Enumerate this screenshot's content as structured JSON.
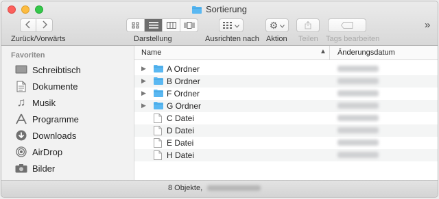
{
  "window": {
    "title": "Sortierung"
  },
  "toolbar": {
    "nav_label": "Zurück/Vorwärts",
    "view_label": "Darstellung",
    "arrange_label": "Ausrichten nach",
    "action_label": "Aktion",
    "share_label": "Teilen",
    "tags_label": "Tags bearbeiten",
    "overflow": "»"
  },
  "sidebar": {
    "heading": "Favoriten",
    "items": [
      {
        "label": "Schreibtisch",
        "icon": "desktop-icon"
      },
      {
        "label": "Dokumente",
        "icon": "document-icon"
      },
      {
        "label": "Musik",
        "icon": "music-icon"
      },
      {
        "label": "Programme",
        "icon": "apps-icon"
      },
      {
        "label": "Downloads",
        "icon": "download-icon"
      },
      {
        "label": "AirDrop",
        "icon": "airdrop-icon"
      },
      {
        "label": "Bilder",
        "icon": "camera-icon"
      }
    ]
  },
  "columns": {
    "name": "Name",
    "date": "Änderungsdatum"
  },
  "files": [
    {
      "name": "A Ordner",
      "type": "folder"
    },
    {
      "name": "B Ordner",
      "type": "folder"
    },
    {
      "name": "F Ordner",
      "type": "folder"
    },
    {
      "name": "G Ordner",
      "type": "folder"
    },
    {
      "name": "C Datei",
      "type": "file"
    },
    {
      "name": "D Datei",
      "type": "file"
    },
    {
      "name": "E Datei",
      "type": "file"
    },
    {
      "name": "H Datei",
      "type": "file"
    }
  ],
  "status": {
    "count_text": "8 Objekte,"
  },
  "colors": {
    "folder": "#5ab8f2",
    "accent": "#6d6d6d"
  }
}
